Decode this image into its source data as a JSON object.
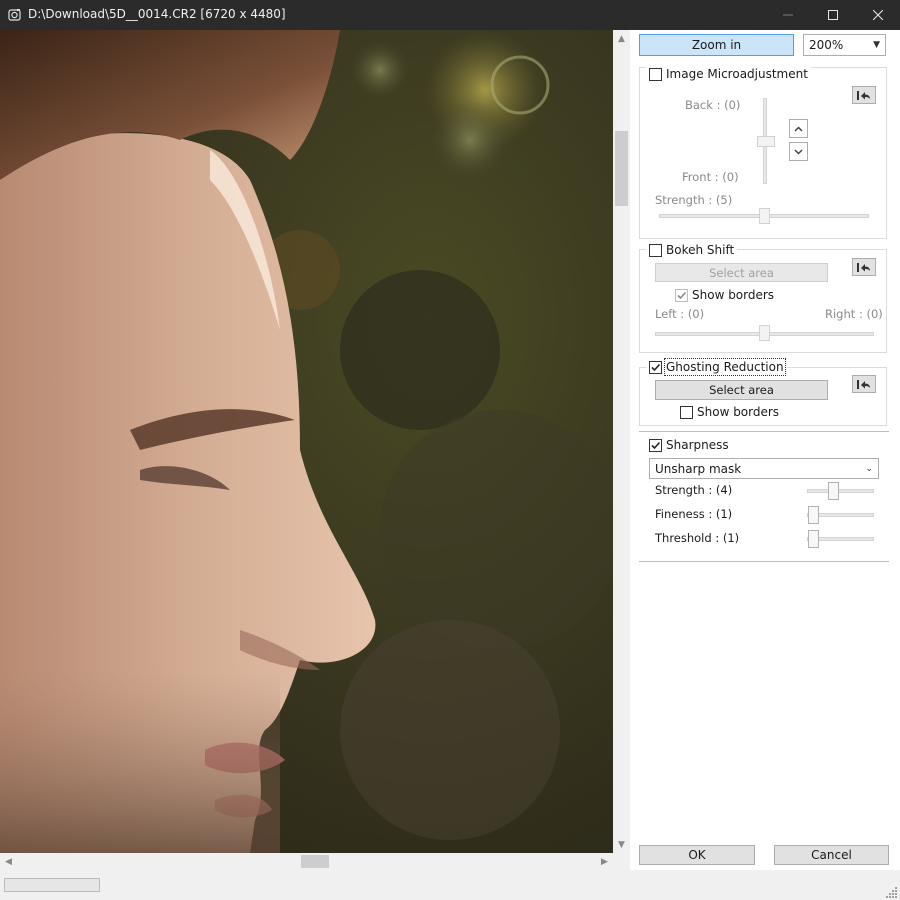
{
  "window": {
    "title": "D:\\Download\\5D__0014.CR2 [6720 x 4480]"
  },
  "toolbar": {
    "zoom_in_label": "Zoom in",
    "zoom_value": "200%"
  },
  "microadjustment": {
    "title": "Image Microadjustment",
    "checked": false,
    "back_label": "Back : (0)",
    "front_label": "Front : (0)",
    "strength_label": "Strength : (5)",
    "strength_value": 5
  },
  "bokeh_shift": {
    "title": "Bokeh Shift",
    "checked": false,
    "select_area_label": "Select area",
    "show_borders_label": "Show borders",
    "show_borders_checked": true,
    "left_label": "Left : (0)",
    "right_label": "Right : (0)"
  },
  "ghosting_reduction": {
    "title": "Ghosting Reduction",
    "checked": true,
    "select_area_label": "Select area",
    "show_borders_label": "Show borders",
    "show_borders_checked": false
  },
  "sharpness": {
    "title": "Sharpness",
    "checked": true,
    "mode": "Unsharp mask",
    "strength_label": "Strength : (4)",
    "strength_value": 4,
    "fineness_label": "Fineness : (1)",
    "fineness_value": 1,
    "threshold_label": "Threshold : (1)",
    "threshold_value": 1
  },
  "footer": {
    "ok_label": "OK",
    "cancel_label": "Cancel"
  },
  "icons": {
    "app": "app-icon",
    "reset": "reset-icon",
    "up": "chevron-up-icon",
    "down": "chevron-down-icon"
  },
  "colors": {
    "titlebar": "#2b2b2b",
    "zoom_pressed": "#cce4f7",
    "zoom_border": "#569de5"
  }
}
